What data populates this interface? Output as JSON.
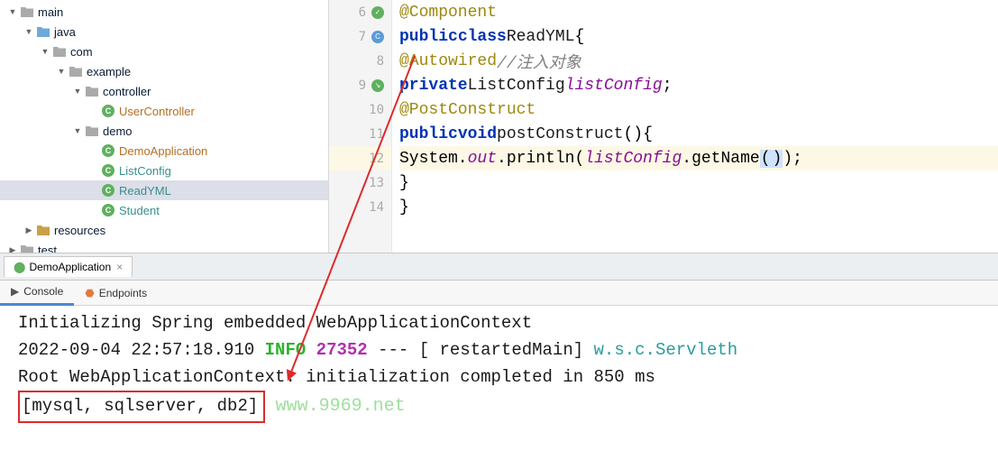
{
  "tree": {
    "main": "main",
    "java": "java",
    "com": "com",
    "example": "example",
    "controller": "controller",
    "usercontroller": "UserController",
    "demo": "demo",
    "demoapplication": "DemoApplication",
    "listconfig": "ListConfig",
    "readyml": "ReadYML",
    "student": "Student",
    "resources": "resources",
    "test": "test"
  },
  "lineNumbers": [
    "6",
    "7",
    "8",
    "9",
    "10",
    "11",
    "12",
    "13",
    "14"
  ],
  "code": {
    "l6_ann": "@Component",
    "l7_kw1": "public",
    "l7_kw2": "class",
    "l7_cls": "ReadYML",
    "l7_b": "{",
    "l8_ann": "@Autowired",
    "l8_cmt": "//注入对象",
    "l9_kw": "private",
    "l9_type": "ListConfig",
    "l9_fld": "listConfig",
    "l9_sc": ";",
    "l10_ann": "@PostConstruct",
    "l11_kw1": "public",
    "l11_kw2": "void",
    "l11_m": "postConstruct",
    "l11_par": "(){",
    "l12_a": "System.",
    "l12_out": "out",
    "l12_b": ".println(",
    "l12_fld": "listConfig",
    "l12_c": ".getName",
    "l12_p1": "(",
    "l12_p2": ")",
    "l12_d": ");",
    "l13": "}",
    "l14": "}"
  },
  "run": {
    "tabName": "DemoApplication",
    "console": "Console",
    "endpoints": "Endpoints"
  },
  "consoleLines": {
    "l1": "Initializing Spring embedded WebApplicationContext",
    "l2_ts": "2022-09-04 22:57:18.910",
    "l2_level": "INFO",
    "l2_pid": "27352",
    "l2_mid": " --- [  restartedMain] ",
    "l2_cls": "w.s.c.Servleth",
    "l3": "Root WebApplicationContext: initialization completed in 850 ms",
    "l4": "[mysql, sqlserver, db2]"
  },
  "watermark": "www.9969.net"
}
